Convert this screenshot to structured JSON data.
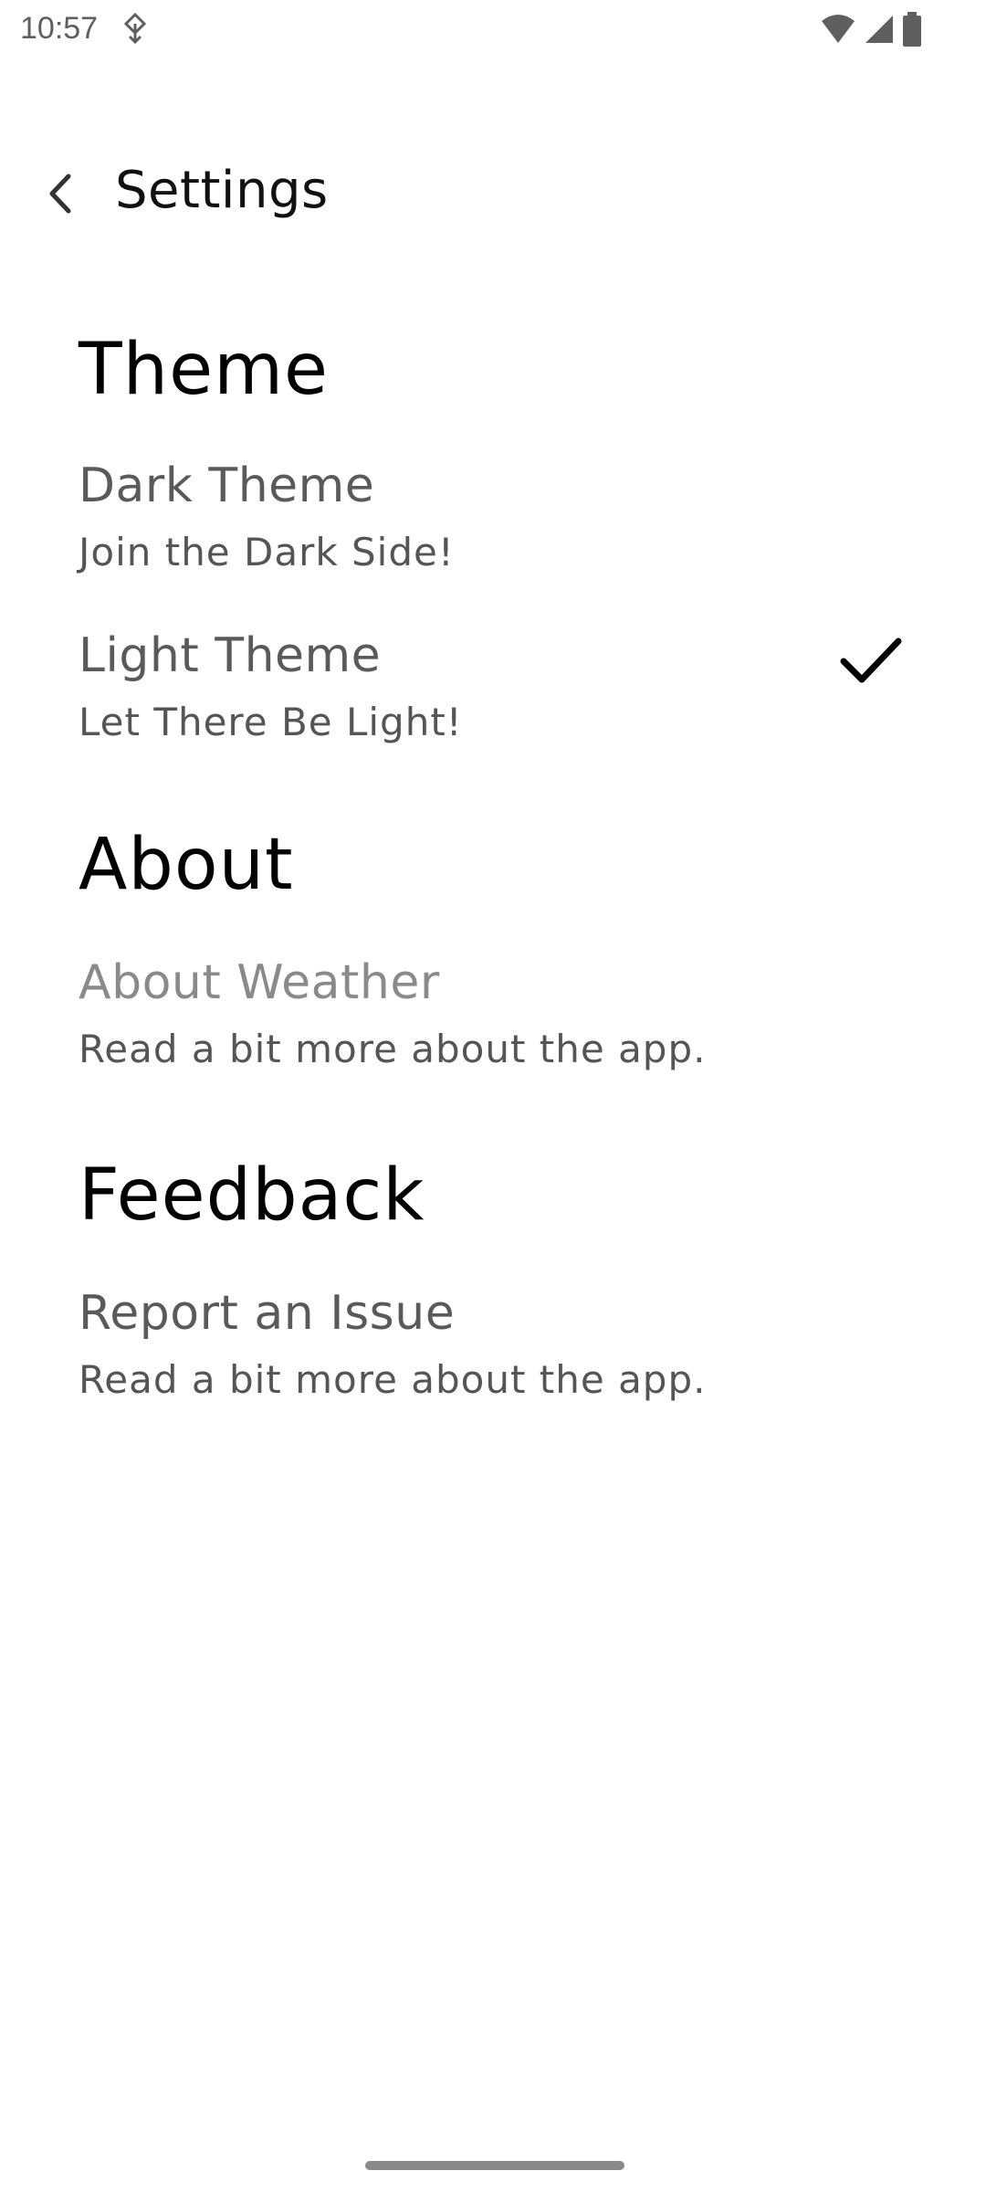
{
  "status_bar": {
    "time": "10:57",
    "icons": [
      "vpn-key-icon",
      "wifi-icon",
      "signal-icon",
      "battery-icon"
    ]
  },
  "app_bar": {
    "title": "Settings",
    "back_icon": "chevron-left-icon"
  },
  "sections": [
    {
      "title": "Theme",
      "items": [
        {
          "title": "Dark Theme",
          "summary": "Join the Dark Side!",
          "selected": false
        },
        {
          "title": "Light Theme",
          "summary": "Let There Be Light!",
          "selected": true
        }
      ]
    },
    {
      "title": "About",
      "items": [
        {
          "title": "About Weather",
          "summary": "Read a bit more about the app."
        }
      ]
    },
    {
      "title": "Feedback",
      "items": [
        {
          "title": "Report an Issue",
          "summary": "Read a bit more about the app."
        }
      ]
    }
  ],
  "colors": {
    "background": "#ffffff",
    "text_primary": "#000000",
    "text_secondary": "#5a5a5a",
    "text_dim": "#8a8a8a"
  }
}
